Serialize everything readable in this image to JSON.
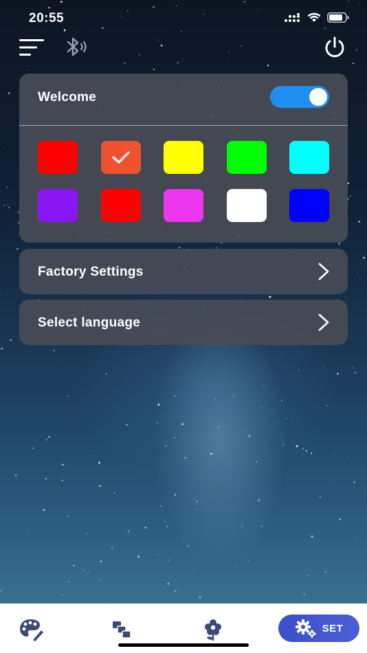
{
  "status_bar": {
    "time": "20:55"
  },
  "welcome": {
    "label": "Welcome",
    "toggle_on": true,
    "toggle_color": "#1f8ef1"
  },
  "swatches": [
    {
      "color": "#ff0000",
      "selected": false
    },
    {
      "color": "#f0522d",
      "selected": true
    },
    {
      "color": "#ffff00",
      "selected": false
    },
    {
      "color": "#00ff00",
      "selected": false
    },
    {
      "color": "#00ffff",
      "selected": false
    },
    {
      "color": "#8b16f5",
      "selected": false
    },
    {
      "color": "#ff0000",
      "selected": false
    },
    {
      "color": "#ec36f0",
      "selected": false
    },
    {
      "color": "#ffffff",
      "selected": false
    },
    {
      "color": "#0000ff",
      "selected": false
    }
  ],
  "menu_rows": {
    "factory_settings": "Factory Settings",
    "select_language": "Select language"
  },
  "tabbar": {
    "tabs": [
      {
        "icon": "palette-icon"
      },
      {
        "icon": "scenes-icon"
      },
      {
        "icon": "flower-icon"
      },
      {
        "icon": "gear-icon",
        "label": "SET",
        "active": true
      }
    ],
    "active_color": "#3a50c8"
  }
}
